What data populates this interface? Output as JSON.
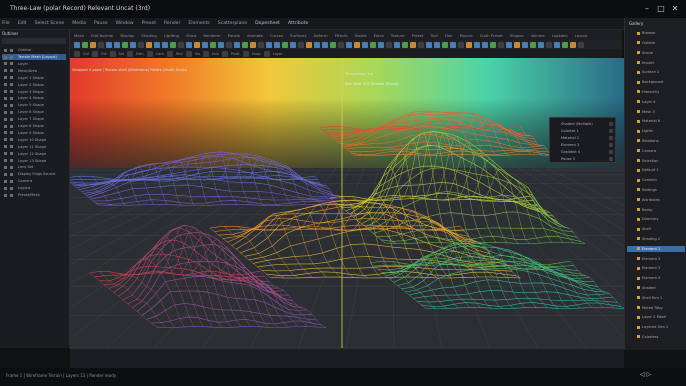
{
  "window": {
    "title": "Three-Law (polar Record) Relevant Uncat (3rd)",
    "controls": [
      "–",
      "□",
      "✕"
    ]
  },
  "menubar": {
    "items": [
      "File",
      "Edit",
      "Select Scene",
      "Media",
      "Pause",
      "Window",
      "Preset",
      "Render",
      "Elements",
      "Scatterplane",
      "Dopesheet",
      "Attribute"
    ]
  },
  "toolbar": {
    "row1": [
      "Mesh",
      "Edit Normal",
      "Display",
      "Shading",
      "Lighting",
      "Show",
      "Renderer",
      "Panels",
      "Animate",
      "Curves",
      "Surfaces",
      "Deform",
      "Effects",
      "Toolkit",
      "Extra",
      "Texture",
      "Preset",
      "Tool",
      "Hair",
      "Muscle",
      "Cloth Preset",
      "Shapes",
      "Volume",
      "Lookdev",
      "Layout"
    ],
    "row3": [
      "Ctrl",
      "Fol",
      "Sel",
      "Nrm",
      "Cam",
      "Shd",
      "Vis",
      "Info",
      "Pivot",
      "Snap",
      "Layer"
    ]
  },
  "outliner": {
    "header": "Outliner",
    "items": [
      {
        "label": "Outline",
        "selected": false
      },
      {
        "label": "Terrain Mesh (Layout)",
        "selected": true
      },
      {
        "label": "Layer",
        "selected": false
      },
      {
        "label": "Mesh/Area",
        "selected": false
      },
      {
        "label": "Layer 1 Shape",
        "selected": false
      },
      {
        "label": "Layer 2 Shape",
        "selected": false
      },
      {
        "label": "Layer 3 Shape",
        "selected": false
      },
      {
        "label": "Layer 4 Shape",
        "selected": false
      },
      {
        "label": "Layer 5 Shape",
        "selected": false
      },
      {
        "label": "Layer 6 Shape",
        "selected": false
      },
      {
        "label": "Layer 7 Shape",
        "selected": false
      },
      {
        "label": "Layer 8 Shape",
        "selected": false
      },
      {
        "label": "Layer 9 Shape",
        "selected": false
      },
      {
        "label": "Layer 10 Shape",
        "selected": false
      },
      {
        "label": "Layer 11 Shape",
        "selected": false
      },
      {
        "label": "Layer 12 Shape",
        "selected": false
      },
      {
        "label": "Layer 13 Shape",
        "selected": false
      },
      {
        "label": "Lens Set",
        "selected": false
      },
      {
        "label": "Display  Flags  Source",
        "selected": false
      },
      {
        "label": "Camera",
        "selected": false
      },
      {
        "label": "Layout",
        "selected": false
      },
      {
        "label": "Preset/Mesh",
        "selected": false
      }
    ]
  },
  "viewport": {
    "left_header": "Viewport 4 pane | Terrain shell (Wireframe)  Relate (Multi) Sculpt",
    "right_header": "Perspective Top",
    "right_sub": "Ren View  XYZ  Shaded Display"
  },
  "floating_panel": {
    "items": [
      "Shaded (Multiple)",
      "Colorize 1",
      "Material 2",
      "Element 3",
      "Gradient 4",
      "Pause 5"
    ]
  },
  "right_panel": {
    "header": "Gallery",
    "items": [
      {
        "label": "Browse",
        "selected": false
      },
      {
        "label": "Outline",
        "selected": false
      },
      {
        "label": "Scene",
        "selected": false
      },
      {
        "label": "Import",
        "selected": false
      },
      {
        "label": "Surface 2",
        "selected": false
      },
      {
        "label": "Background",
        "selected": false
      },
      {
        "label": "Hierarchy",
        "selected": false
      },
      {
        "label": "Layer 4",
        "selected": false
      },
      {
        "label": "Mesh 5",
        "selected": false
      },
      {
        "label": "Material 6",
        "selected": false
      },
      {
        "label": "Lights",
        "selected": false
      },
      {
        "label": "Relations",
        "selected": false
      },
      {
        "label": "Camera",
        "selected": false
      },
      {
        "label": "Selection",
        "selected": false
      },
      {
        "label": "Default 1",
        "selected": false
      },
      {
        "label": "Connect",
        "selected": false
      },
      {
        "label": "Settings",
        "selected": false
      },
      {
        "label": "Attributes",
        "selected": false
      },
      {
        "label": "Ramp",
        "selected": false
      },
      {
        "label": "Directory",
        "selected": false
      },
      {
        "label": "Shell",
        "selected": false
      },
      {
        "label": "Shading 2",
        "selected": false
      },
      {
        "label": "Element 1",
        "selected": true
      },
      {
        "label": "Element 2",
        "selected": false
      },
      {
        "label": "Element 3",
        "selected": false
      },
      {
        "label": "Element 4",
        "selected": false
      },
      {
        "label": "Shaded",
        "selected": false
      },
      {
        "label": "Shell Rim 1",
        "selected": false
      },
      {
        "label": "Muted Toby",
        "selected": false
      },
      {
        "label": "Layer 2 Mesh",
        "selected": false
      },
      {
        "label": "Layered Gen 2",
        "selected": false
      },
      {
        "label": "Colorless",
        "selected": false
      }
    ]
  },
  "status": {
    "left": "Frame 1 | Wireframe Terrain | Layers 13 | Render ready",
    "right": "◁ ▷"
  },
  "colors": {
    "accent": "#3a6ea8",
    "wire_red": "#e0403a",
    "wire_orange": "#f08a2a",
    "wire_yellow": "#e8d23a",
    "wire_green": "#5fc048",
    "wire_teal": "#2ec0b0",
    "wire_purple": "#8c5ad8",
    "wire_blue": "#5a78e0"
  }
}
